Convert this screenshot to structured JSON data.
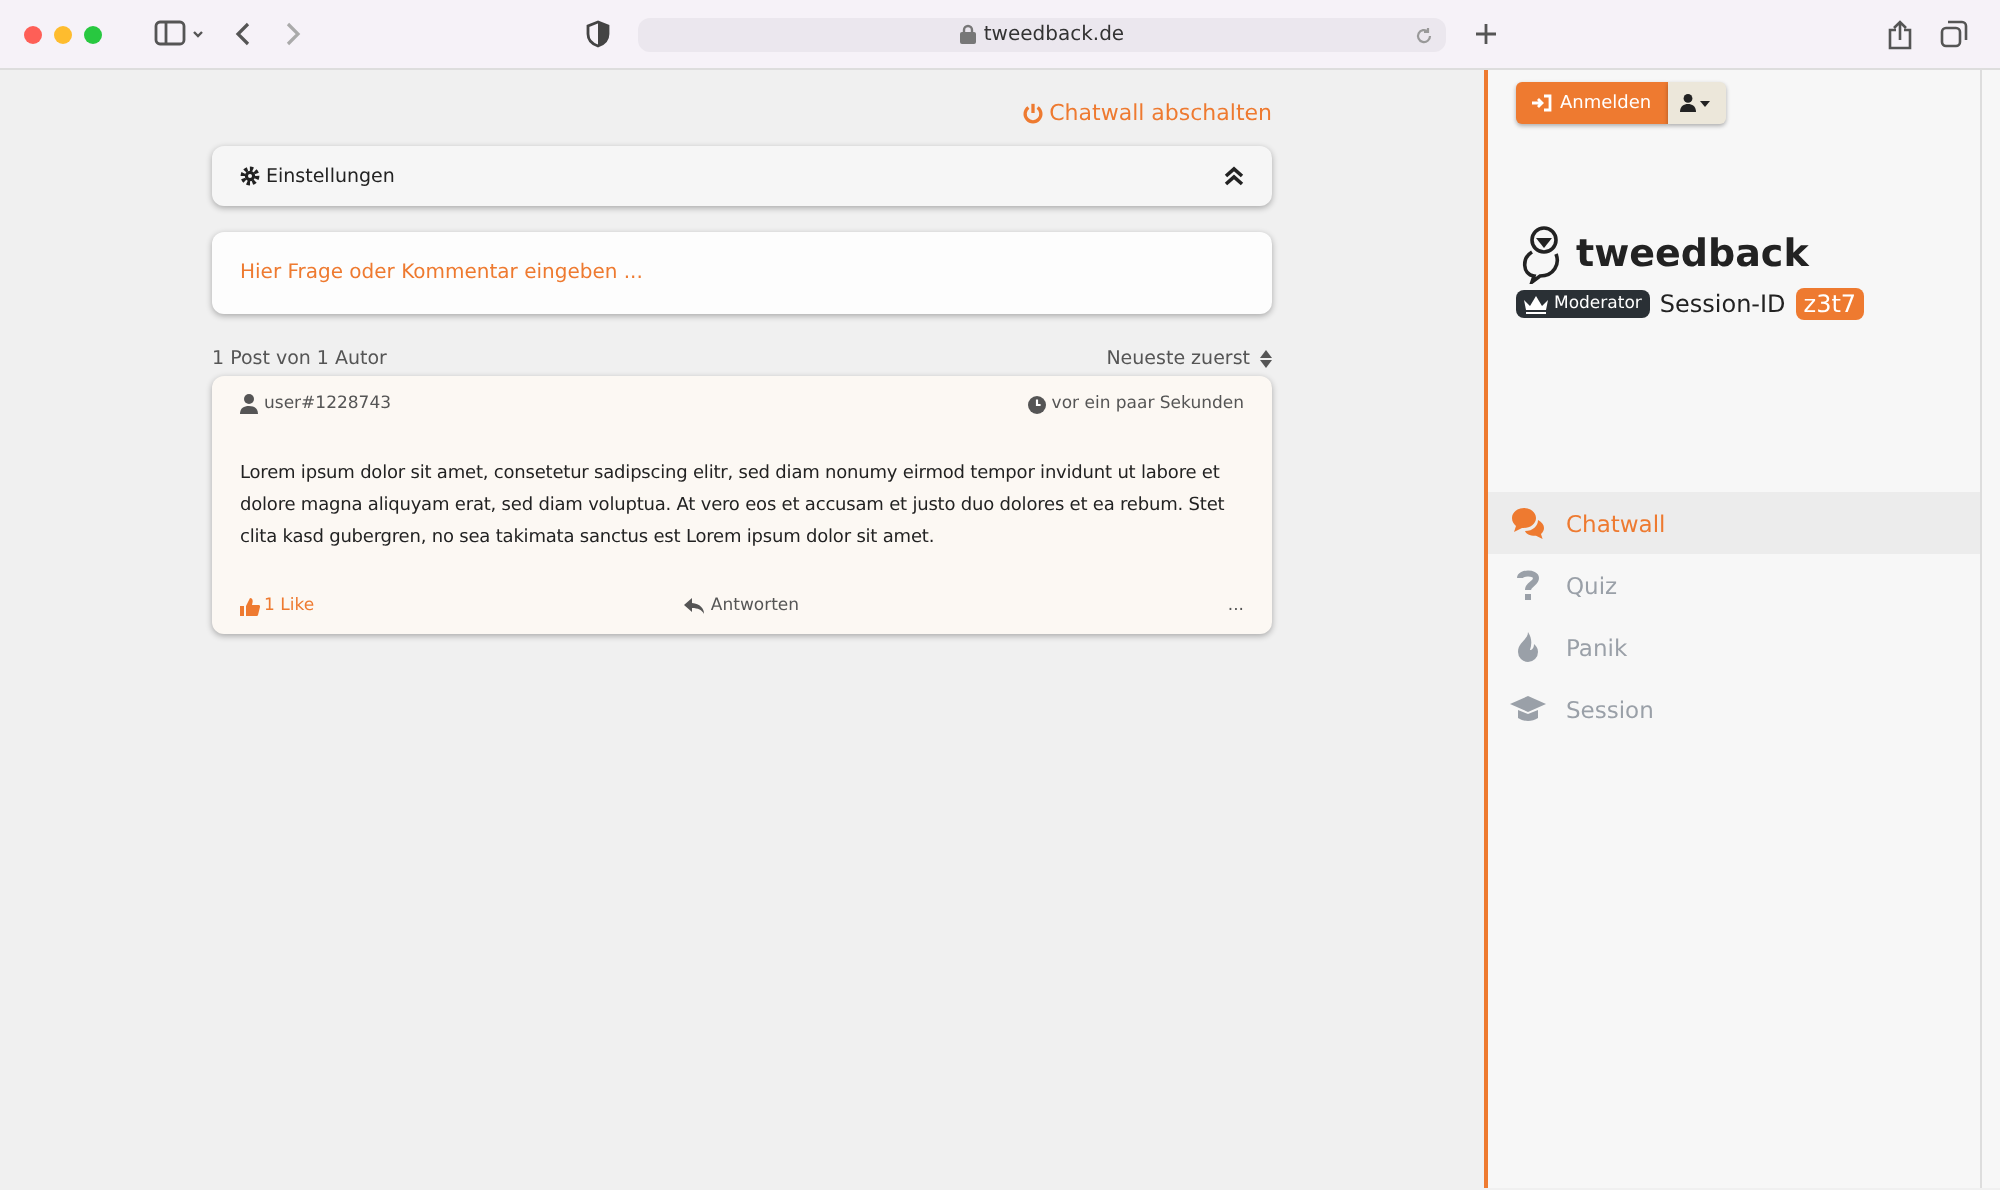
{
  "browser": {
    "url": "tweedback.de"
  },
  "chatwall_toggle": "Chatwall abschalten",
  "settings": {
    "title": "Einstellungen",
    "expanded": true
  },
  "composer": {
    "placeholder": "Hier Frage oder Kommentar eingeben ..."
  },
  "summary": "1 Post von 1 Autor",
  "sort": "Neueste zuerst",
  "posts": [
    {
      "author": "user#1228743",
      "time": "vor ein paar Sekunden",
      "text": "Lorem ipsum dolor sit amet, consetetur sadipscing elitr, sed diam nonumy eirmod tempor invidunt ut labore et dolore magna aliquyam erat, sed diam voluptua. At vero eos et accusam et justo duo dolores et ea rebum. Stet clita kasd gubergren, no sea takimata sanctus est Lorem ipsum dolor sit amet.",
      "likes": "1 Like",
      "liked": true,
      "reply": "Antworten",
      "more": "..."
    }
  ],
  "sidebar": {
    "login": "Anmelden",
    "brand": "tweedback",
    "role": "Moderator",
    "session_label": "Session-ID",
    "session_id": "z3t7",
    "nav": [
      {
        "kind": "chat",
        "label": "Chatwall",
        "selected": true
      },
      {
        "kind": "quiz",
        "label": "Quiz",
        "selected": false
      },
      {
        "kind": "panic",
        "label": "Panik",
        "selected": false
      },
      {
        "kind": "session",
        "label": "Session",
        "selected": false
      }
    ]
  }
}
